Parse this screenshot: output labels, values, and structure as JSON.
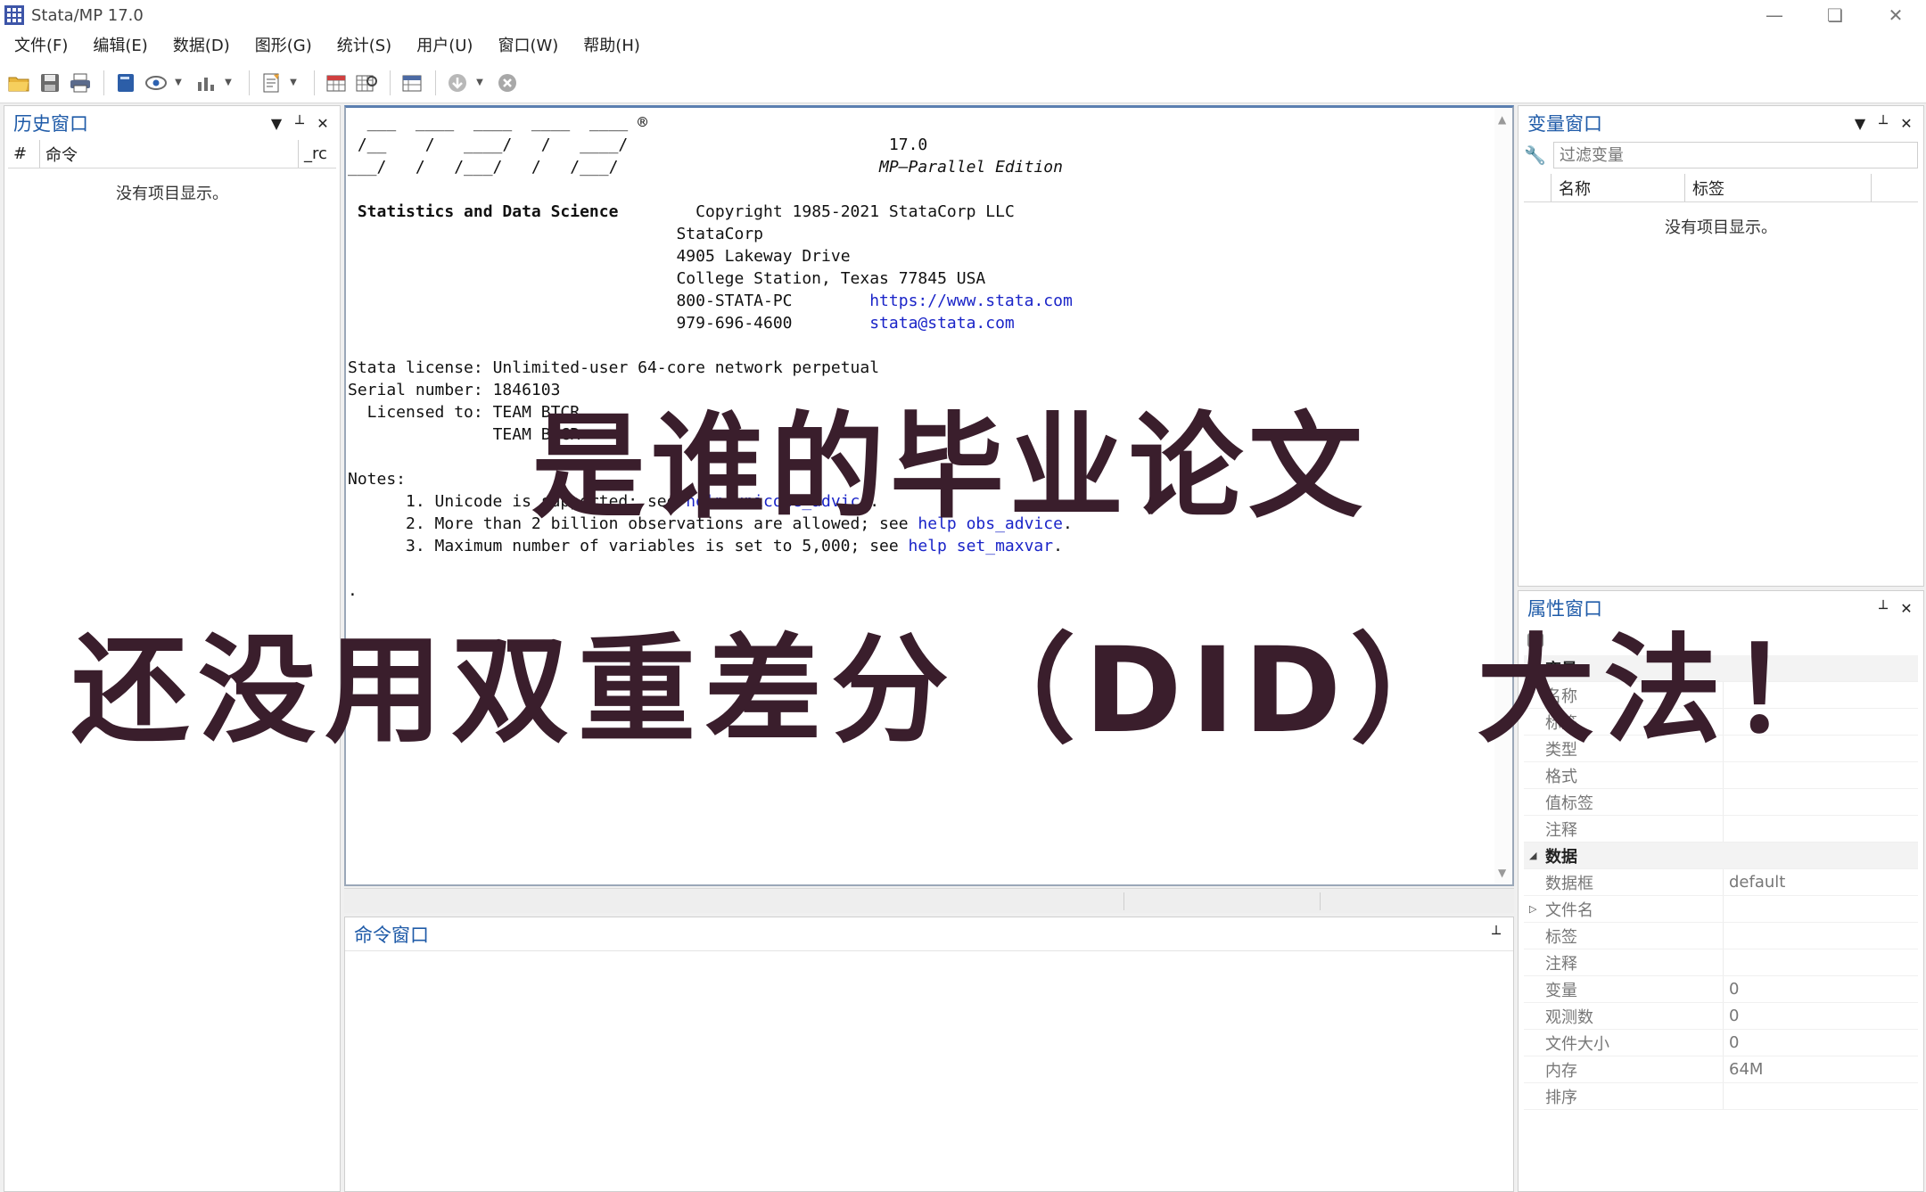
{
  "window": {
    "title": "Stata/MP 17.0"
  },
  "menu": [
    "文件(F)",
    "编辑(E)",
    "数据(D)",
    "图形(G)",
    "统计(S)",
    "用户(U)",
    "窗口(W)",
    "帮助(H)"
  ],
  "history": {
    "title": "历史窗口",
    "col_num": "#",
    "col_cmd": "命令",
    "col_rc": "_rc",
    "empty": "没有项目显示。"
  },
  "results": {
    "logo_line1": "  ___  ____  ____  ____  ____ ®",
    "logo_line2": " /__    /   ____/   /   ____/",
    "logo_line3": "___/   /   /___/   /   /___/",
    "version": "17.0",
    "edition": "MP—Parallel Edition",
    "tagline": "Statistics and Data Science",
    "copyright": "Copyright 1985-2021 StataCorp LLC",
    "company": "StataCorp",
    "address1": "4905 Lakeway Drive",
    "address2": "College Station, Texas 77845 USA",
    "phone1": "800-STATA-PC",
    "url": "https://www.stata.com",
    "phone2": "979-696-4600",
    "email": "stata@stata.com",
    "license_label": "Stata license: ",
    "license_value": "Unlimited-user 64-core network perpetual",
    "serial_label": "Serial number: ",
    "serial_value": "1846103",
    "licensed_label": "  Licensed to: ",
    "licensed_value1": "TEAM BTCR",
    "licensed_value2": "TEAM BTCR",
    "notes_label": "Notes:",
    "note1_pre": "      1. Unicode is supported; see ",
    "note1_link": "help unicode_advice",
    "note2_pre": "      2. More than 2 billion observations are allowed; see ",
    "note2_link": "help obs_advice",
    "note3_pre": "      3. Maximum number of variables is set to 5,000; see ",
    "note3_link": "help set_maxvar",
    "prompt": "."
  },
  "command": {
    "title": "命令窗口"
  },
  "variables": {
    "title": "变量窗口",
    "filter_placeholder": "过滤变量",
    "col_name": "名称",
    "col_label": "标签",
    "empty": "没有项目显示。"
  },
  "properties": {
    "title": "属性窗口",
    "var_section": "变量",
    "var_rows": [
      {
        "k": "名称",
        "v": ""
      },
      {
        "k": "标签",
        "v": ""
      },
      {
        "k": "类型",
        "v": ""
      },
      {
        "k": "格式",
        "v": ""
      },
      {
        "k": "值标签",
        "v": ""
      },
      {
        "k": "注释",
        "v": ""
      }
    ],
    "data_section": "数据",
    "data_rows": [
      {
        "k": "数据框",
        "v": "default"
      },
      {
        "k": "文件名",
        "v": ""
      },
      {
        "k": "标签",
        "v": ""
      },
      {
        "k": "注释",
        "v": ""
      },
      {
        "k": "变量",
        "v": "0"
      },
      {
        "k": "观测数",
        "v": "0"
      },
      {
        "k": "文件大小",
        "v": "0"
      },
      {
        "k": "内存",
        "v": "64M"
      },
      {
        "k": "排序",
        "v": ""
      }
    ]
  },
  "overlay": {
    "line1": "是谁的毕业论文",
    "line2": "还没用双重差分（DID）大法！"
  }
}
